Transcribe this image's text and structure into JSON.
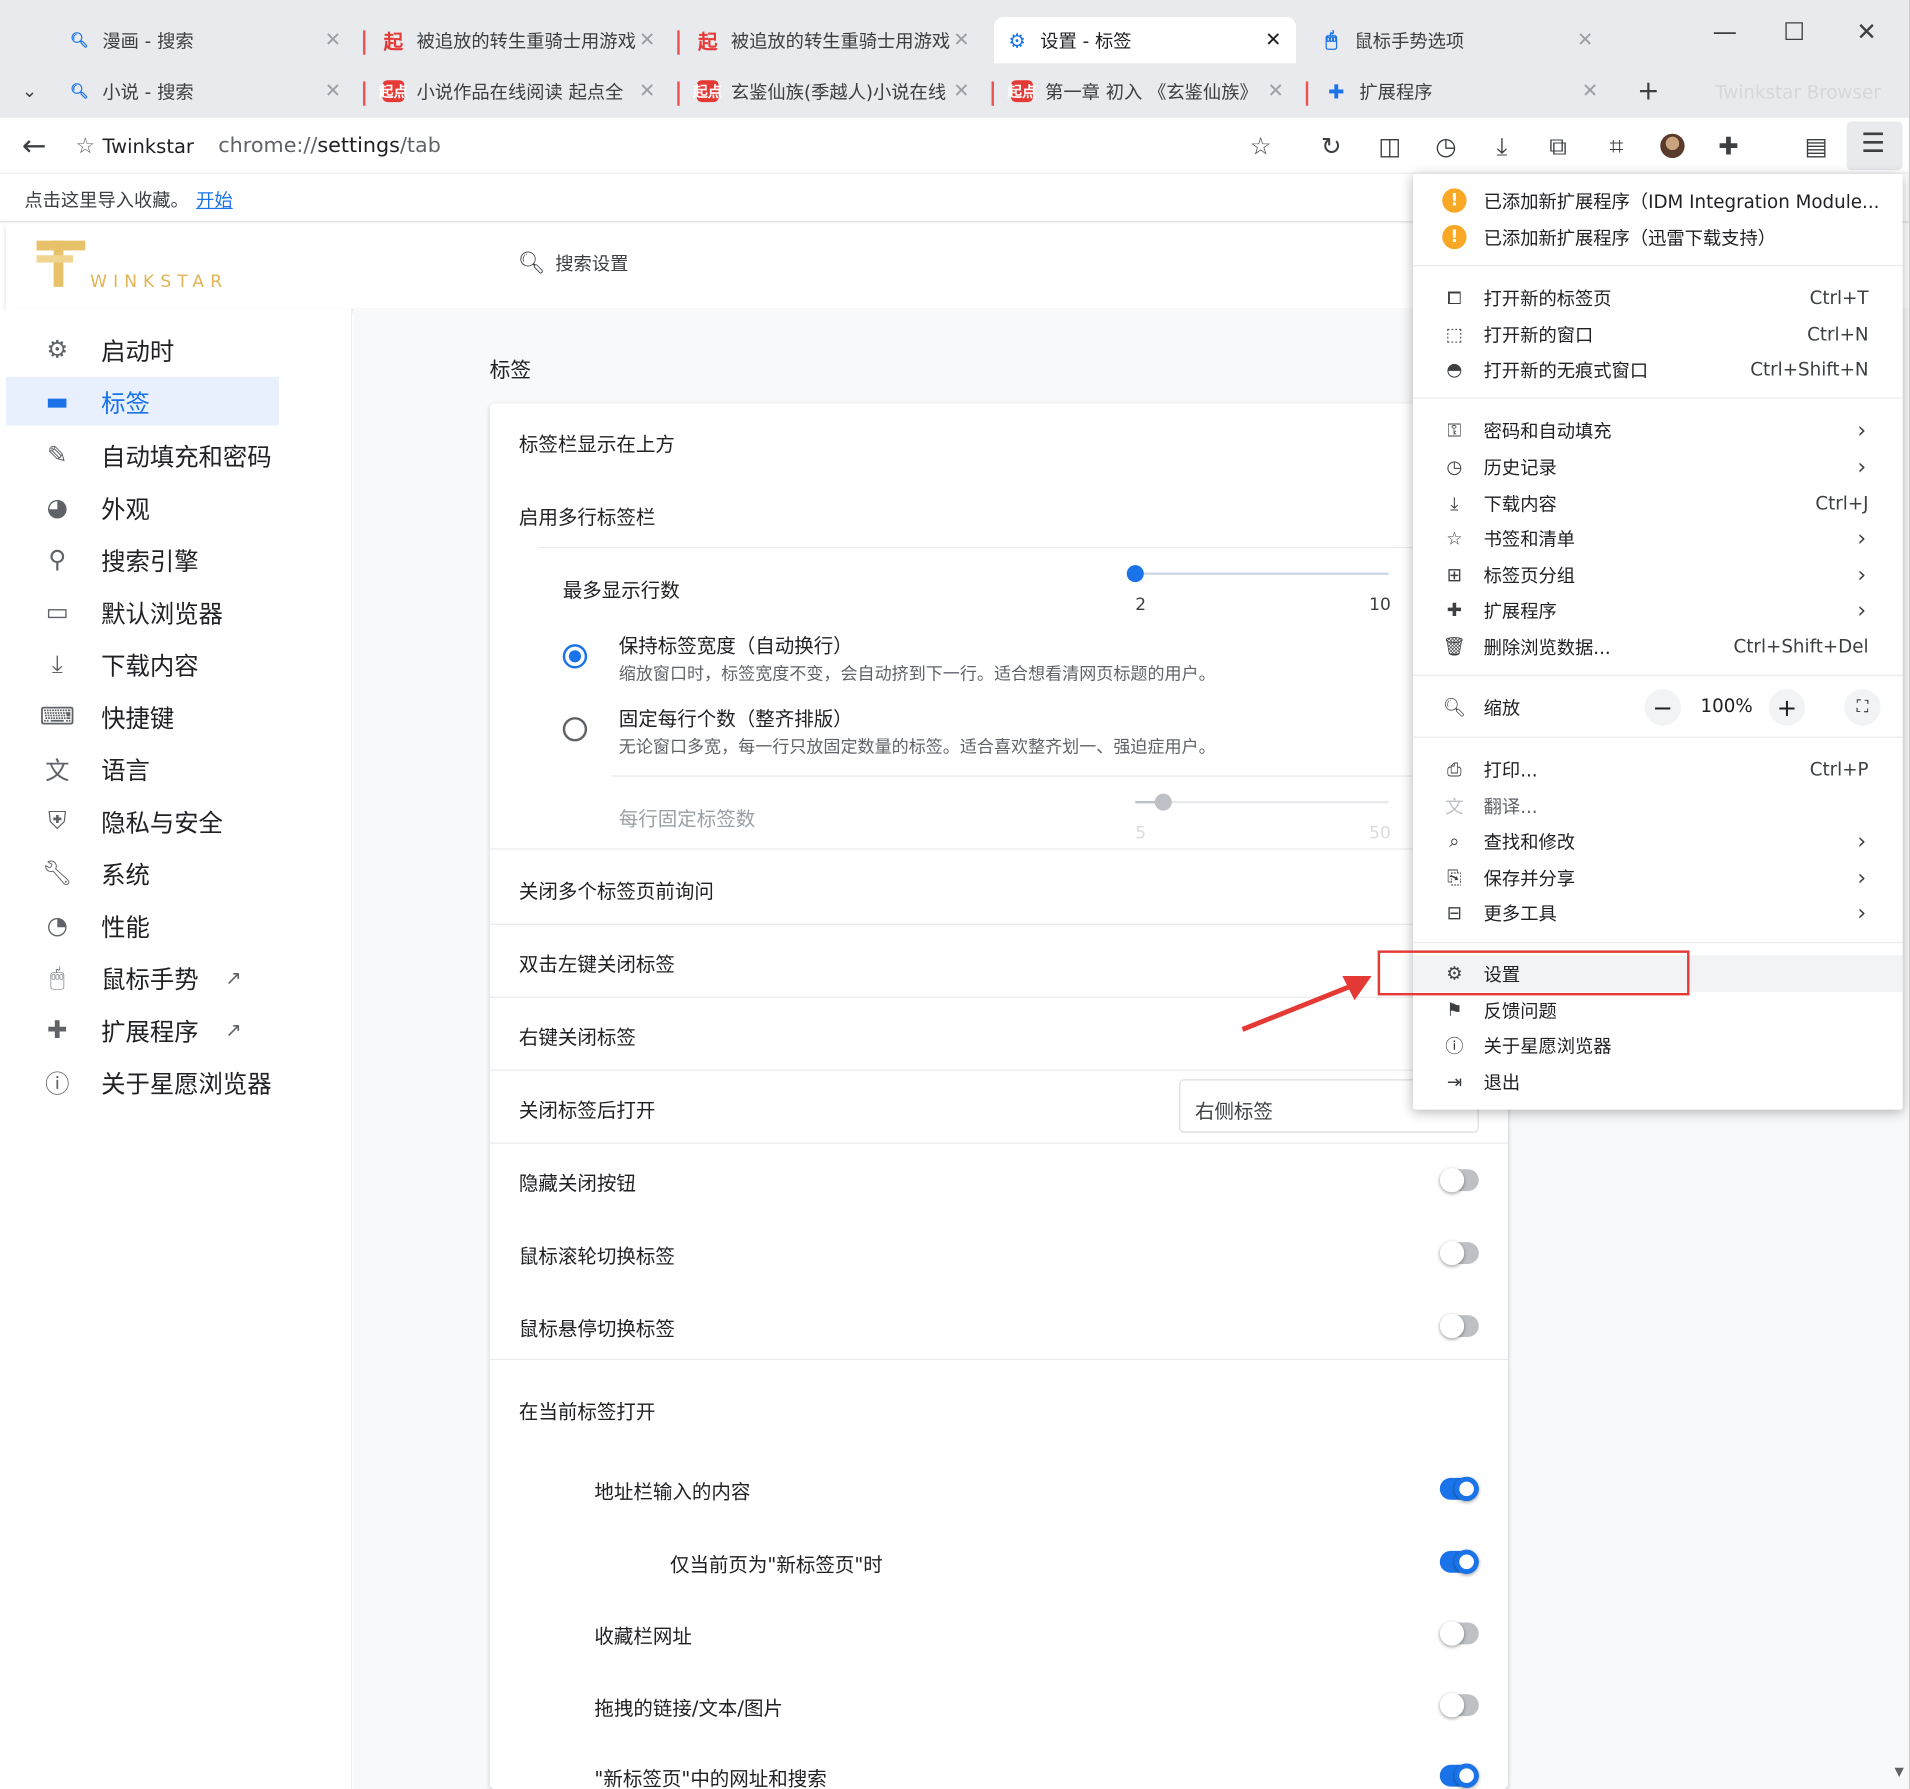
{
  "window": {
    "ghost_brand": "Twinkstar Browser",
    "controls": [
      "—",
      "☐",
      "✕"
    ]
  },
  "tabs_row1": [
    {
      "title": "漫画 - 搜索",
      "icon": "search-icon"
    },
    {
      "title": "被追放的转生重骑士用游戏",
      "icon": "qidian-icon"
    },
    {
      "title": "被追放的转生重骑士用游戏",
      "icon": "qidian-icon"
    },
    {
      "title": "设置 - 标签",
      "icon": "gear-icon",
      "active": true
    },
    {
      "title": "鼠标手势选项",
      "icon": "mouse-icon"
    }
  ],
  "tabs_row2": [
    {
      "title": "小说 - 搜索",
      "icon": "search-icon"
    },
    {
      "title": "小说作品在线阅读 起点全",
      "icon": "qidian-icon"
    },
    {
      "title": "玄鉴仙族(季越人)小说在线",
      "icon": "qidian-icon"
    },
    {
      "title": "第一章 初入 《玄鉴仙族》",
      "icon": "qidian-icon"
    },
    {
      "title": "扩展程序",
      "icon": "puzzle-icon"
    }
  ],
  "new_tab": "+",
  "toolbar": {
    "site_name": "Twinkstar",
    "url_scheme": "chrome://",
    "url_host": "settings",
    "url_path": "/tab"
  },
  "bookmark_bar": {
    "text": "点击这里导入收藏。",
    "link": "开始"
  },
  "header": {
    "logo_text": "WINKSTAR",
    "search_placeholder": "搜索设置"
  },
  "sidebar": {
    "items": [
      {
        "label": "启动时",
        "icon": "gear-icon"
      },
      {
        "label": "标签",
        "icon": "tab-icon",
        "active": true
      },
      {
        "label": "自动填充和密码",
        "icon": "edit-icon"
      },
      {
        "label": "外观",
        "icon": "palette-icon"
      },
      {
        "label": "搜索引擎",
        "icon": "search-icon"
      },
      {
        "label": "默认浏览器",
        "icon": "browser-icon"
      },
      {
        "label": "下载内容",
        "icon": "download-icon"
      },
      {
        "label": "快捷键",
        "icon": "keyboard-icon"
      },
      {
        "label": "语言",
        "icon": "translate-icon"
      },
      {
        "label": "隐私与安全",
        "icon": "shield-icon"
      },
      {
        "label": "系统",
        "icon": "wrench-icon"
      },
      {
        "label": "性能",
        "icon": "gauge-icon"
      },
      {
        "label": "鼠标手势",
        "icon": "mouse-icon",
        "external": true
      },
      {
        "label": "扩展程序",
        "icon": "puzzle-icon",
        "external": true
      },
      {
        "label": "关于星愿浏览器",
        "icon": "info-icon"
      }
    ]
  },
  "content": {
    "section_title": "标签",
    "rows": {
      "tabbar_top": "标签栏显示在上方",
      "multi_row": "启用多行标签栏",
      "max_rows": "最多显示行数",
      "max_rows_min": "2",
      "max_rows_max": "10",
      "max_rows_value": 2,
      "keep_width_title": "保持标签宽度（自动换行）",
      "keep_width_desc": "缩放窗口时，标签宽度不变，会自动挤到下一行。适合想看清网页标题的用户。",
      "fixed_count_title": "固定每行个数（整齐排版）",
      "fixed_count_desc": "无论窗口多宽，每一行只放固定数量的标签。适合喜欢整齐划一、强迫症用户。",
      "per_row": "每行固定标签数",
      "per_row_min": "5",
      "per_row_max": "50",
      "per_row_value": 10,
      "confirm_close_multi": "关闭多个标签页前询问",
      "dblclick_close": "双击左键关闭标签",
      "rightclick_close": "右键关闭标签",
      "after_close": "关闭标签后打开",
      "after_close_value": "右侧标签",
      "hide_close": "隐藏关闭按钮",
      "wheel_switch": "鼠标滚轮切换标签",
      "hover_switch": "鼠标悬停切换标签",
      "open_in_current": "在当前标签打开",
      "address_input": "地址栏输入的内容",
      "only_newtab": "仅当前页为\"新标签页\"时",
      "bookmark_url": "收藏栏网址",
      "drag_link": "拖拽的链接/文本/图片",
      "newtab_search": "\"新标签页\"中的网址和搜索"
    }
  },
  "menu": {
    "alerts": [
      "已添加新扩展程序（IDM Integration Module...",
      "已添加新扩展程序（迅雷下载支持）"
    ],
    "group1": [
      {
        "label": "打开新的标签页",
        "shortcut": "Ctrl+T",
        "icon": "new-tab-icon"
      },
      {
        "label": "打开新的窗口",
        "shortcut": "Ctrl+N",
        "icon": "new-window-icon"
      },
      {
        "label": "打开新的无痕式窗口",
        "shortcut": "Ctrl+Shift+N",
        "icon": "incognito-icon"
      }
    ],
    "group2": [
      {
        "label": "密码和自动填充",
        "arrow": true,
        "icon": "key-icon"
      },
      {
        "label": "历史记录",
        "arrow": true,
        "icon": "history-icon"
      },
      {
        "label": "下载内容",
        "shortcut": "Ctrl+J",
        "icon": "download-icon"
      },
      {
        "label": "书签和清单",
        "arrow": true,
        "icon": "star-icon"
      },
      {
        "label": "标签页分组",
        "arrow": true,
        "icon": "grid-icon"
      },
      {
        "label": "扩展程序",
        "arrow": true,
        "icon": "puzzle-icon"
      },
      {
        "label": "删除浏览数据...",
        "shortcut": "Ctrl+Shift+Del",
        "icon": "trash-icon"
      }
    ],
    "zoom": {
      "label": "缩放",
      "value": "100%",
      "minus": "−",
      "plus": "+"
    },
    "group3": [
      {
        "label": "打印...",
        "shortcut": "Ctrl+P",
        "icon": "print-icon"
      },
      {
        "label": "翻译...",
        "icon": "translate-icon",
        "disabled": true
      },
      {
        "label": "查找和修改",
        "arrow": true,
        "icon": "find-icon"
      },
      {
        "label": "保存并分享",
        "arrow": true,
        "icon": "save-icon"
      },
      {
        "label": "更多工具",
        "arrow": true,
        "icon": "toolbox-icon"
      }
    ],
    "group4": [
      {
        "label": "设置",
        "icon": "gear-icon",
        "highlighted": true
      },
      {
        "label": "反馈问题",
        "icon": "feedback-icon"
      },
      {
        "label": "关于星愿浏览器",
        "icon": "info-icon"
      },
      {
        "label": "退出",
        "icon": "exit-icon"
      }
    ]
  },
  "colors": {
    "accent": "#1a73e8",
    "annotation_red": "#e53935",
    "logo_gold": "#e0b455"
  }
}
